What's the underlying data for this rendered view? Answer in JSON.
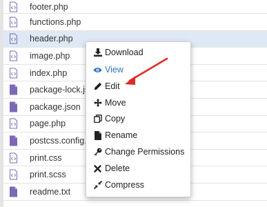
{
  "files": [
    {
      "name": "footer.php",
      "icon": "php-file-icon"
    },
    {
      "name": "functions.php",
      "icon": "php-file-icon"
    },
    {
      "name": "header.php",
      "icon": "php-file-icon",
      "selected": true
    },
    {
      "name": "image.php",
      "icon": "php-file-icon"
    },
    {
      "name": "index.php",
      "icon": "php-file-icon"
    },
    {
      "name": "package-lock.json",
      "icon": "file-icon"
    },
    {
      "name": "package.json",
      "icon": "file-icon"
    },
    {
      "name": "page.php",
      "icon": "php-file-icon"
    },
    {
      "name": "postcss.config.js",
      "icon": "file-icon"
    },
    {
      "name": "print.css",
      "icon": "php-file-icon"
    },
    {
      "name": "print.scss",
      "icon": "php-file-icon"
    },
    {
      "name": "readme.txt",
      "icon": "file-icon"
    }
  ],
  "context_menu": {
    "download": "Download",
    "view": "View",
    "edit": "Edit",
    "move": "Move",
    "copy": "Copy",
    "rename": "Rename",
    "change_permissions": "Change Permissions",
    "delete": "Delete",
    "compress": "Compress"
  },
  "colors": {
    "selected_row": "#dfe9f5",
    "file_icon": "#7b68b7",
    "view_link": "#2d73b8",
    "annotation_arrow": "#e02a25"
  }
}
